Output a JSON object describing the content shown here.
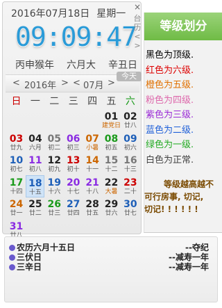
{
  "header": {
    "date": "2016年07月18日",
    "weekday": "星期一",
    "close_glyph": "×",
    "clock": "09:09:47",
    "side_tabs": [
      "台",
      "历",
      "<",
      ">"
    ],
    "lunar": [
      "丙申猴年",
      "六月大",
      "辛丑日"
    ]
  },
  "nav": {
    "prev_year": "<",
    "year": "2016年",
    "next_year": ">",
    "prev_month": "<",
    "month": "07月",
    "next_month": ">",
    "today": "今天"
  },
  "weekdays": [
    "日",
    "一",
    "二",
    "三",
    "四",
    "五",
    "六"
  ],
  "weekday_colors": [
    "#cc0000",
    "#444444",
    "#444444",
    "#444444",
    "#444444",
    "#444444",
    "#1a9a1a"
  ],
  "days": [
    {
      "n": "01",
      "sub": "建党日",
      "col": 5,
      "row": 0,
      "color": "#222222",
      "sub_color": "#cc6600"
    },
    {
      "n": "02",
      "sub": "廿八",
      "col": 6,
      "row": 0,
      "color": "#222222"
    },
    {
      "n": "03",
      "sub": "廿九",
      "col": 0,
      "row": 1,
      "color": "#cc0000"
    },
    {
      "n": "04",
      "sub": "六月",
      "col": 1,
      "row": 1,
      "color": "#222222"
    },
    {
      "n": "05",
      "sub": "初二",
      "col": 2,
      "row": 1,
      "color": "#777777"
    },
    {
      "n": "06",
      "sub": "初三",
      "col": 3,
      "row": 1,
      "color": "#8a2be2"
    },
    {
      "n": "07",
      "sub": "小暑",
      "col": 4,
      "row": 1,
      "color": "#cc6600",
      "sub_color": "#cc6600"
    },
    {
      "n": "08",
      "sub": "初五",
      "col": 5,
      "row": 1,
      "color": "#1a9a1a"
    },
    {
      "n": "09",
      "sub": "初六",
      "col": 6,
      "row": 1,
      "color": "#1e5fb8"
    },
    {
      "n": "10",
      "sub": "初七",
      "col": 0,
      "row": 2,
      "color": "#1e5fb8"
    },
    {
      "n": "11",
      "sub": "初八",
      "col": 1,
      "row": 2,
      "color": "#8a2be2"
    },
    {
      "n": "12",
      "sub": "初九",
      "col": 2,
      "row": 2,
      "color": "#222222"
    },
    {
      "n": "13",
      "sub": "初十",
      "col": 3,
      "row": 2,
      "color": "#cc0000"
    },
    {
      "n": "14",
      "sub": "十一",
      "col": 4,
      "row": 2,
      "color": "#cc6600"
    },
    {
      "n": "15",
      "sub": "十二",
      "col": 5,
      "row": 2,
      "color": "#777777"
    },
    {
      "n": "16",
      "sub": "十三",
      "col": 6,
      "row": 2,
      "color": "#777777"
    },
    {
      "n": "17",
      "sub": "十四",
      "col": 0,
      "row": 3,
      "color": "#1a9a1a"
    },
    {
      "n": "18",
      "sub": "十五",
      "col": 1,
      "row": 3,
      "color": "#1e5fb8",
      "selected": true
    },
    {
      "n": "19",
      "sub": "十六",
      "col": 2,
      "row": 3,
      "color": "#1e5fb8"
    },
    {
      "n": "20",
      "sub": "十七",
      "col": 3,
      "row": 3,
      "color": "#8a2be2"
    },
    {
      "n": "21",
      "sub": "十八",
      "col": 4,
      "row": 3,
      "color": "#8a2be2"
    },
    {
      "n": "22",
      "sub": "大暑",
      "col": 5,
      "row": 3,
      "color": "#222222",
      "sub_color": "#cc6600"
    },
    {
      "n": "23",
      "sub": "二十",
      "col": 6,
      "row": 3,
      "color": "#cc0000"
    },
    {
      "n": "24",
      "sub": "廿一",
      "col": 0,
      "row": 4,
      "color": "#cc6600"
    },
    {
      "n": "25",
      "sub": "廿二",
      "col": 1,
      "row": 4,
      "color": "#222222"
    },
    {
      "n": "26",
      "sub": "廿三",
      "col": 2,
      "row": 4,
      "color": "#1a9a1a"
    },
    {
      "n": "27",
      "sub": "廿四",
      "col": 3,
      "row": 4,
      "color": "#1e5fb8"
    },
    {
      "n": "28",
      "sub": "廿五",
      "col": 4,
      "row": 4,
      "color": "#222222"
    },
    {
      "n": "29",
      "sub": "廿六",
      "col": 5,
      "row": 4,
      "color": "#222222"
    },
    {
      "n": "30",
      "sub": "廿七",
      "col": 6,
      "row": 4,
      "color": "#1e5fb8"
    },
    {
      "n": "31",
      "sub": "廿八",
      "col": 0,
      "row": 5,
      "color": "#8a2be2"
    }
  ],
  "level_panel": {
    "title": "等级划分",
    "items": [
      {
        "text": "黑色为顶级.",
        "color": "#000000"
      },
      {
        "text": "红色为六级.",
        "color": "#dd0000"
      },
      {
        "text": "橙色为五级.",
        "color": "#e07000"
      },
      {
        "text": "粉色为四级.",
        "color": "#dd66aa"
      },
      {
        "text": "紫色为三级.",
        "color": "#9a2ad6"
      },
      {
        "text": "蓝色为二级.",
        "color": "#1e5fd8"
      },
      {
        "text": "绿色为一级.",
        "color": "#22aa22"
      },
      {
        "text": "白色为正常.",
        "color": "#444444"
      }
    ],
    "note_line1": "等级越高越不",
    "note_line2": "可行房事, 切记,",
    "note_line3": "切记! ! ! ! ! !"
  },
  "info": {
    "rows": [
      {
        "left": "农历六月十五日",
        "right": "--夺纪"
      },
      {
        "left": "三伏日",
        "right": "--减寿一年"
      },
      {
        "left": "三辛日",
        "right": "--减寿一年"
      }
    ],
    "dot_color": "#6a5acd"
  }
}
